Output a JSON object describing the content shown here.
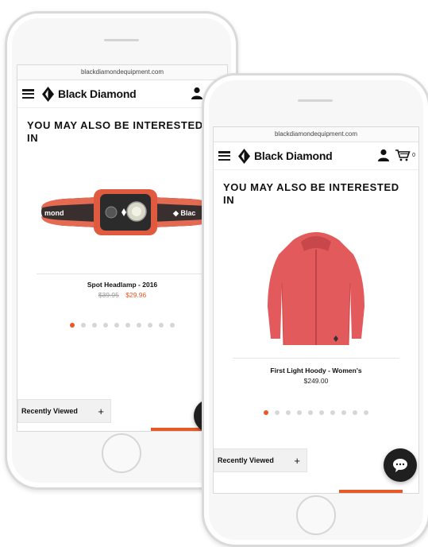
{
  "browser": {
    "url": "blackdiamondequipment.com"
  },
  "brand": {
    "name": "Black Diamond",
    "accent": "#e8592a"
  },
  "header": {
    "menu_icon": "hamburger-icon",
    "account_icon": "user-icon",
    "cart_icon": "cart-icon",
    "cart_count": "0"
  },
  "section": {
    "title": "YOU MAY ALSO BE INTERESTED IN"
  },
  "back_phone": {
    "product": {
      "name": "Spot Headlamp - 2016",
      "original_price": "$39.95",
      "sale_price": "$29.96"
    },
    "carousel": {
      "total": 10,
      "active": 1
    },
    "recently_viewed": {
      "label": "Recently Viewed",
      "toggle": "+"
    }
  },
  "front_phone": {
    "product": {
      "name": "First Light Hoody - Women's",
      "price": "$249.00"
    },
    "carousel": {
      "total": 10,
      "active": 1
    },
    "recently_viewed": {
      "label": "Recently Viewed",
      "toggle": "+"
    }
  },
  "chat": {
    "icon": "chat-bubble-icon"
  }
}
